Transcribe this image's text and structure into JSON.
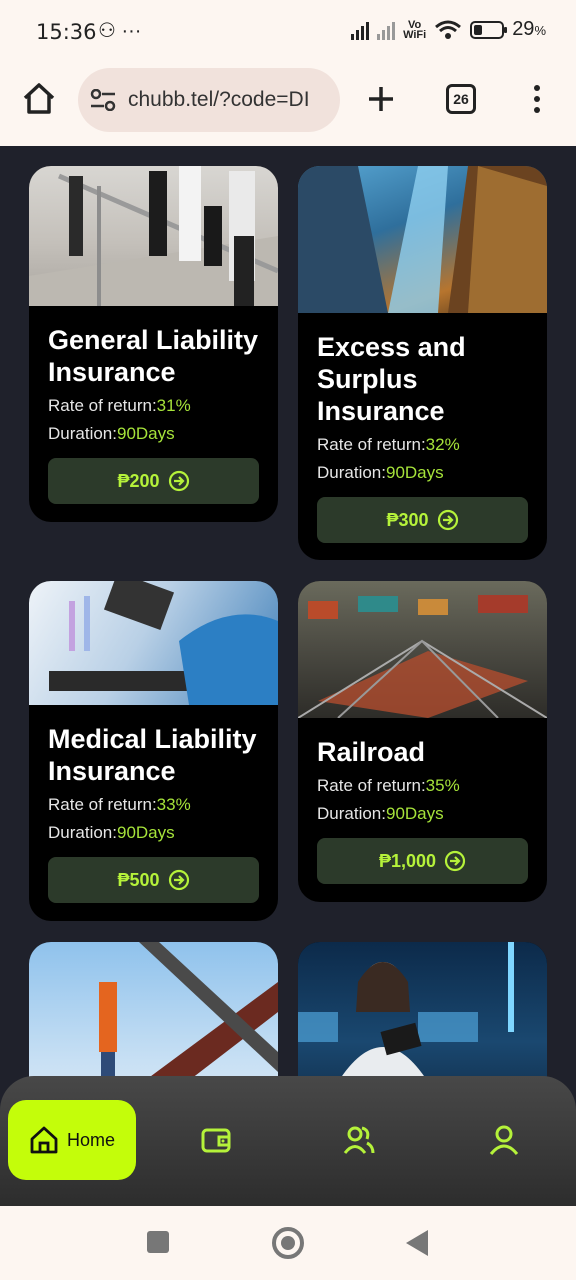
{
  "status_bar": {
    "time": "15:36",
    "left_icons": "⚇ ···",
    "wifi_label_top": "Vo",
    "wifi_label_bottom": "WiFi",
    "battery": "29",
    "battery_unit": "%"
  },
  "browser": {
    "url": "chubb.tel/?code=DI",
    "tab_count": "26"
  },
  "cards": [
    {
      "title": "General Liability Insurance",
      "rate_label": "Rate of return:",
      "rate": "31%",
      "duration_label": "Duration:",
      "duration": "90Days",
      "price": "₱200"
    },
    {
      "title": "Excess and Surplus Insurance",
      "rate_label": "Rate of return:",
      "rate": "32%",
      "duration_label": "Duration:",
      "duration": "90Days",
      "price": "₱300"
    },
    {
      "title": "Medical Liability Insurance",
      "rate_label": "Rate of return:",
      "rate": "33%",
      "duration_label": "Duration:",
      "duration": "90Days",
      "price": "₱500"
    },
    {
      "title": "Railroad",
      "rate_label": "Rate of return:",
      "rate": "35%",
      "duration_label": "Duration:",
      "duration": "90Days",
      "price": "₱1,000"
    }
  ],
  "bottom_nav": {
    "home_label": "Home",
    "accent": "#c4fd0a"
  },
  "colors": {
    "background": "#1f212b",
    "card": "#000000",
    "highlight": "#a6e33a",
    "button_bg": "#2c3a2a"
  }
}
